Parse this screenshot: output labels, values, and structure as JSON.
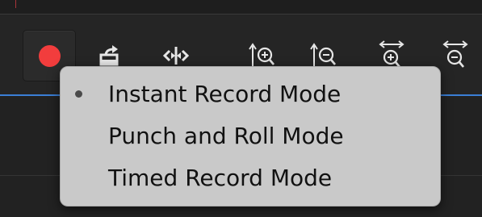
{
  "toolbar": {
    "tools": [
      {
        "icon": "record-icon",
        "active": true
      },
      {
        "icon": "export-icon"
      },
      {
        "icon": "split-icon"
      },
      {
        "icon": "vertical-zoom-in-icon"
      },
      {
        "icon": "vertical-zoom-out-icon"
      },
      {
        "icon": "horizontal-zoom-in-icon"
      },
      {
        "icon": "horizontal-zoom-out-icon"
      }
    ],
    "record_color": "#f23d3d"
  },
  "record_mode_menu": {
    "items": [
      {
        "label": "Instant Record Mode",
        "selected": true
      },
      {
        "label": "Punch and Roll Mode",
        "selected": false
      },
      {
        "label": "Timed Record Mode",
        "selected": false
      }
    ]
  },
  "colors": {
    "timeline_accent": "#3b7fd6",
    "background": "#232323",
    "menu_background": "#c9c9c9"
  }
}
